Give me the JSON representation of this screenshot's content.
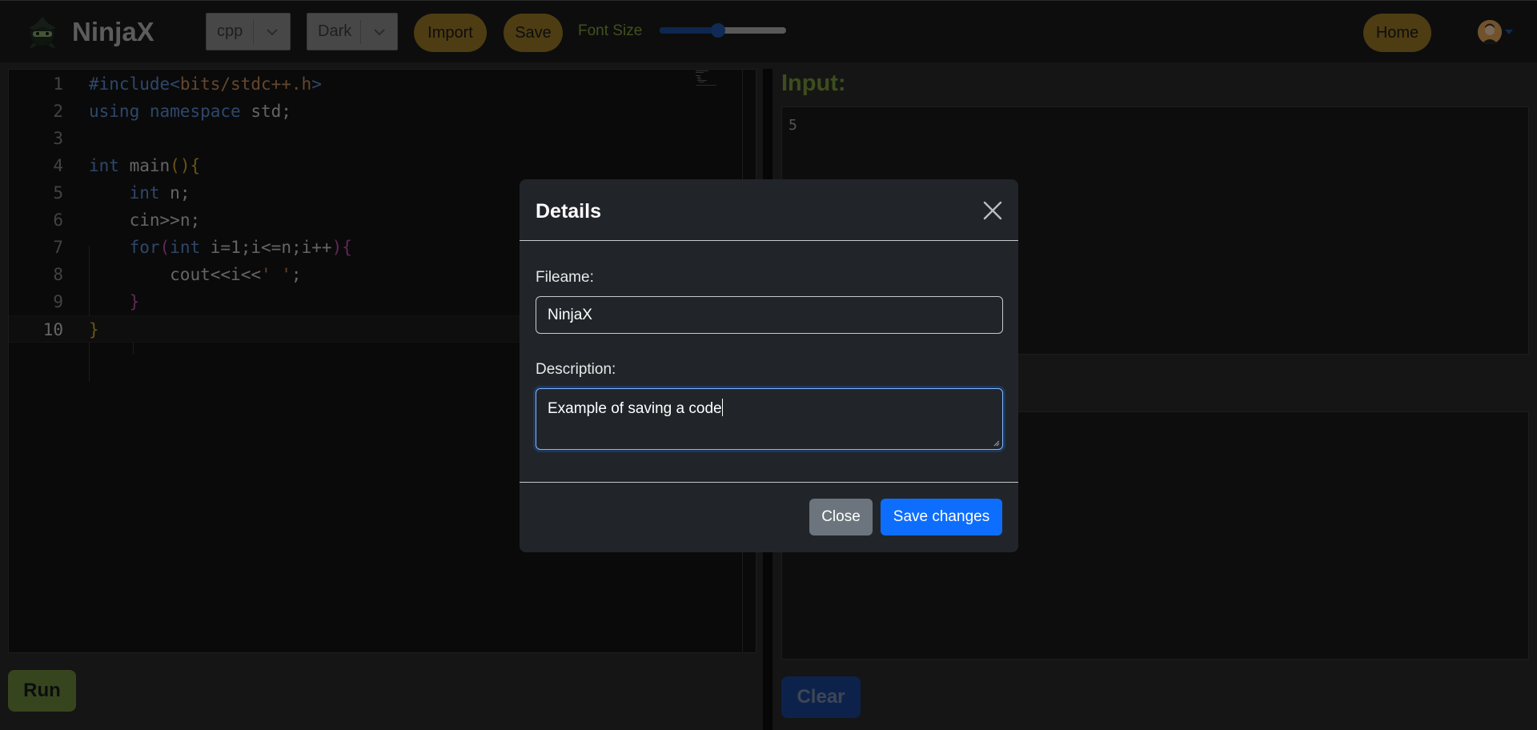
{
  "app": {
    "name": "NinjaX",
    "logo_icon": "ninja-logo-icon"
  },
  "toolbar": {
    "language": "cpp",
    "theme": "Dark",
    "import_label": "Import",
    "save_label": "Save",
    "font_size_label": "Font Size",
    "font_size_level": 0.46,
    "home_label": "Home"
  },
  "editor": {
    "lines": [
      {
        "num": "1",
        "code": "#include<bits/stdc++.h>"
      },
      {
        "num": "2",
        "code": "using namespace std;"
      },
      {
        "num": "3",
        "code": ""
      },
      {
        "num": "4",
        "code": "int main(){"
      },
      {
        "num": "5",
        "code": "    int n;"
      },
      {
        "num": "6",
        "code": "    cin>>n;"
      },
      {
        "num": "7",
        "code": "    for(int i=1;i<=n;i++){"
      },
      {
        "num": "8",
        "code": "        cout<<i<<' ';"
      },
      {
        "num": "9",
        "code": "    }"
      },
      {
        "num": "10",
        "code": "}"
      }
    ],
    "run_label": "Run"
  },
  "io": {
    "input_label": "Input:",
    "input_value": "5",
    "clear_label": "Clear"
  },
  "modal": {
    "title": "Details",
    "filename_label": "Fileame:",
    "filename_value": "NinjaX",
    "description_label": "Description:",
    "description_value": "Example of saving a code",
    "close_label": "Close",
    "save_label": "Save changes"
  },
  "colors": {
    "accent_gold": "#9c7b26",
    "run_green": "#6e8b3d",
    "primary_blue": "#0d6efd",
    "input_label_green": "#7a9b3a"
  }
}
